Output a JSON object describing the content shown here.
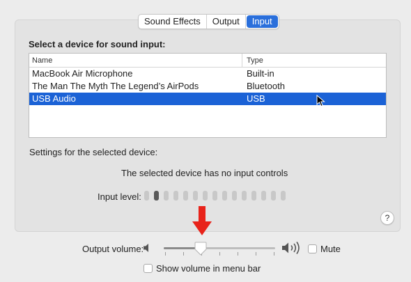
{
  "tabs": [
    {
      "label": "Sound Effects",
      "active": false
    },
    {
      "label": "Output",
      "active": false
    },
    {
      "label": "Input",
      "active": true
    }
  ],
  "section_title": "Select a device for sound input:",
  "table": {
    "columns": [
      "Name",
      "Type"
    ],
    "rows": [
      {
        "name": "MacBook Air Microphone",
        "type": "Built-in",
        "selected": false
      },
      {
        "name": "The Man The Myth The Legend’s AirPods",
        "type": "Bluetooth",
        "selected": false
      },
      {
        "name": "USB Audio",
        "type": "USB",
        "selected": true
      }
    ]
  },
  "settings_label": "Settings for the selected device:",
  "no_input_controls": "The selected device has no input controls",
  "input_level": {
    "label": "Input level:",
    "segments": 15,
    "active_segments": [
      2
    ]
  },
  "help_label": "?",
  "output_volume": {
    "label": "Output volume:",
    "level_fraction": 0.33
  },
  "mute": {
    "label": "Mute",
    "checked": false
  },
  "show_volume": {
    "label": "Show volume in menu bar",
    "checked": false
  },
  "colors": {
    "accent": "#1b62d6",
    "annotation_arrow": "#e8231a"
  },
  "icons": [
    "speaker-low-icon",
    "speaker-high-icon",
    "help-icon",
    "red-down-arrow",
    "mouse-cursor-icon"
  ]
}
